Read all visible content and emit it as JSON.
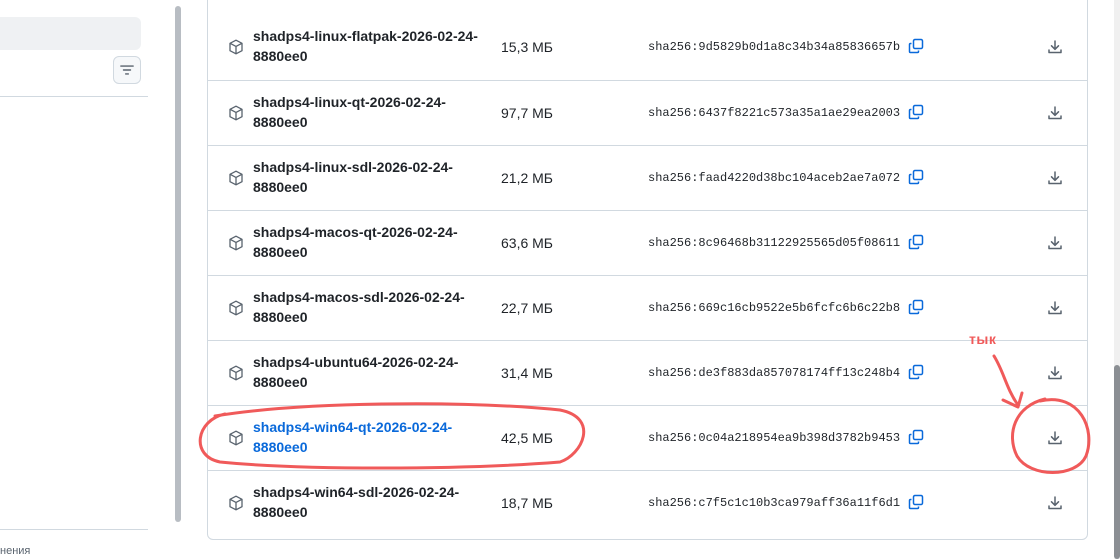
{
  "sidebar": {
    "footer_text": "нения"
  },
  "icons": {
    "filter": "filter-icon",
    "package": "package-icon",
    "copy": "copy-icon",
    "download": "download-icon"
  },
  "colors": {
    "link": "#0969da",
    "text": "#1f2328",
    "border": "#d1d9e0",
    "annotation": "#f05a5a"
  },
  "assets": [
    {
      "name": "shadps4-linux-flatpak-2026-02-24-8880ee0",
      "size": "15,3 МБ",
      "hash": "sha256:9d5829b0d1a8c34b34a85836657b…"
    },
    {
      "name": "shadps4-linux-qt-2026-02-24-8880ee0",
      "size": "97,7 МБ",
      "hash": "sha256:6437f8221c573a35a1ae29ea2003…"
    },
    {
      "name": "shadps4-linux-sdl-2026-02-24-8880ee0",
      "size": "21,2 МБ",
      "hash": "sha256:faad4220d38bc104aceb2ae7a072…"
    },
    {
      "name": "shadps4-macos-qt-2026-02-24-8880ee0",
      "size": "63,6 МБ",
      "hash": "sha256:8c96468b31122925565d05f08611…"
    },
    {
      "name": "shadps4-macos-sdl-2026-02-24-8880ee0",
      "size": "22,7 МБ",
      "hash": "sha256:669c16cb9522e5b6fcfc6b6c22b8…"
    },
    {
      "name": "shadps4-ubuntu64-2026-02-24-8880ee0",
      "size": "31,4 МБ",
      "hash": "sha256:de3f883da857078174ff13c248b4…"
    },
    {
      "name": "shadps4-win64-qt-2026-02-24-8880ee0",
      "size": "42,5 МБ",
      "hash": "sha256:0c04a218954ea9b398d3782b9453…",
      "highlighted": true
    },
    {
      "name": "shadps4-win64-sdl-2026-02-24-8880ee0",
      "size": "18,7 МБ",
      "hash": "sha256:c7f5c1c10b3ca979aff36a11f6d1…"
    }
  ],
  "annotation": {
    "label": "тык"
  }
}
